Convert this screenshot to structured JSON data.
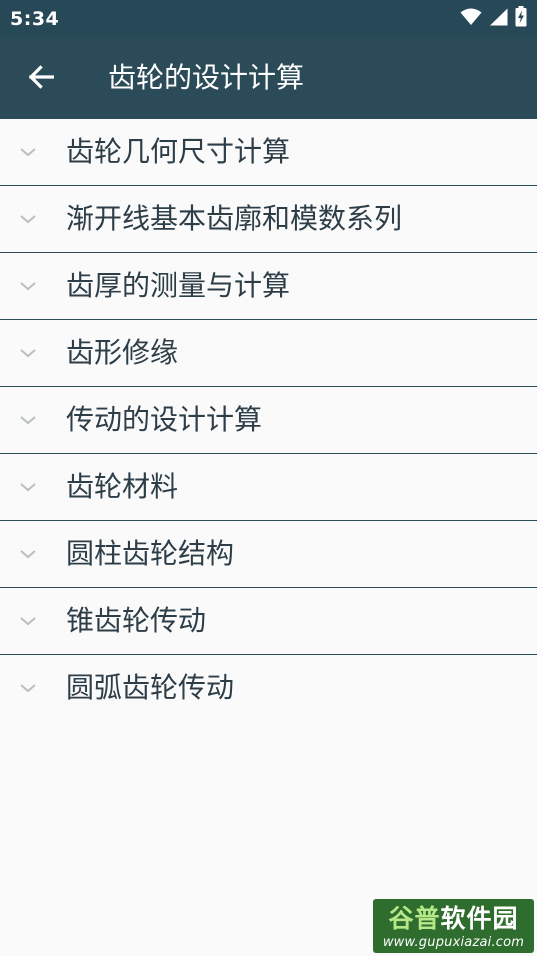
{
  "status_bar": {
    "time": "5:34",
    "icons": [
      "wifi-icon",
      "signal-icon",
      "battery-charging-icon"
    ]
  },
  "app_bar": {
    "back_icon": "arrow-left-icon",
    "title": "齿轮的设计计算"
  },
  "list": {
    "chevron_icon": "chevron-down-icon",
    "items": [
      {
        "label": "齿轮几何尺寸计算"
      },
      {
        "label": "渐开线基本齿廓和模数系列"
      },
      {
        "label": "齿厚的测量与计算"
      },
      {
        "label": "齿形修缘"
      },
      {
        "label": "传动的设计计算"
      },
      {
        "label": "齿轮材料"
      },
      {
        "label": "圆柱齿轮结构"
      },
      {
        "label": "锥齿轮传动"
      },
      {
        "label": "圆弧齿轮传动"
      }
    ]
  },
  "watermark": {
    "title_part1": "谷普",
    "title_part2": "软件园",
    "url": "www.gupuxiazai.com"
  },
  "colors": {
    "status_bar": "#274856",
    "app_bar": "#2c4b59",
    "background": "#fafafa",
    "divider": "#2d4c5a",
    "text": "#2d3e48",
    "chevron": "#b8bec2"
  }
}
